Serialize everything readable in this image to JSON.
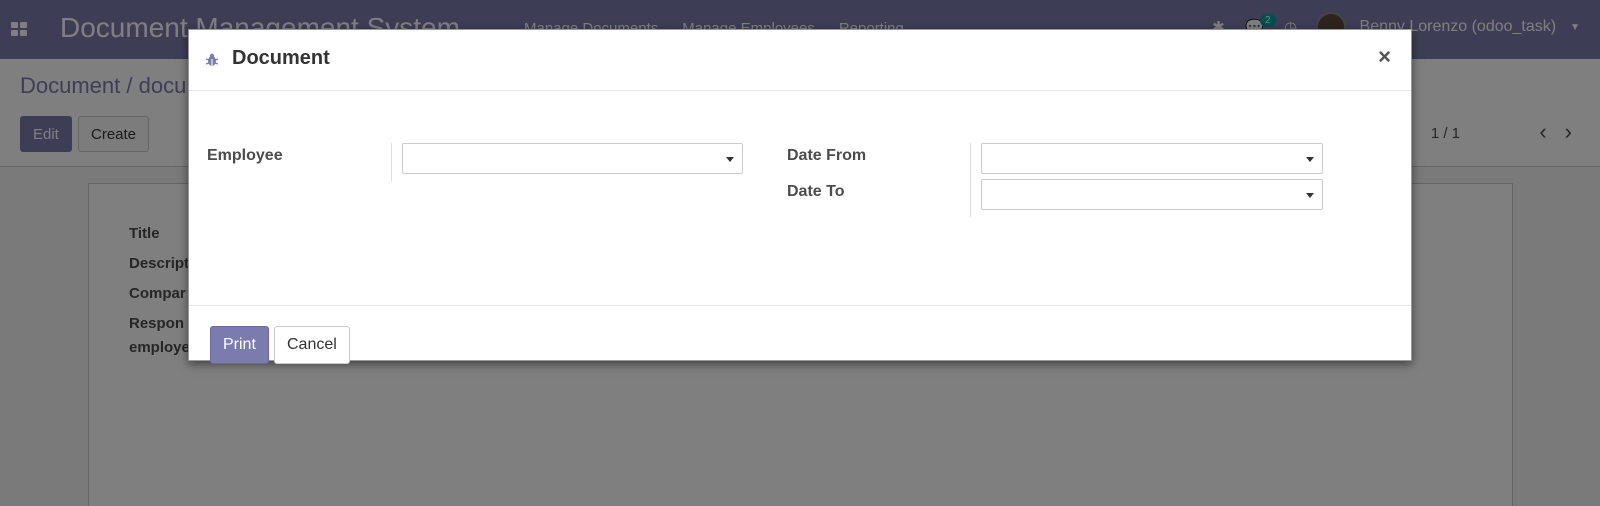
{
  "navbar": {
    "brand": "Document Management System",
    "menu": [
      "Manage Documents",
      "Manage Employees",
      "Reporting"
    ],
    "messages_count": "2",
    "user_name": "Benny Lorenzo (odoo_task)"
  },
  "control": {
    "breadcrumb": "Document / docu",
    "edit_label": "Edit",
    "create_label": "Create",
    "pager": "1 / 1"
  },
  "sheet": {
    "fields": [
      "Title",
      "Descript",
      "Compar",
      "Respon",
      "employe"
    ]
  },
  "modal": {
    "title": "Document",
    "close": "×",
    "employee_label": "Employee",
    "date_from_label": "Date From",
    "date_to_label": "Date To",
    "print_label": "Print",
    "cancel_label": "Cancel"
  },
  "colors": {
    "brand": "#7c7bad",
    "badge": "#00a09d"
  }
}
